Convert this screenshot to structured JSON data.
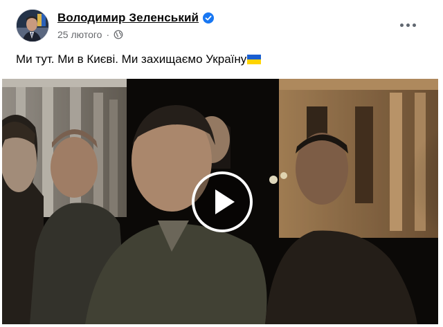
{
  "post": {
    "author": "Володимир Зеленський",
    "verified_icon": "verified-badge-icon",
    "date": "25 лютого",
    "separator": "·",
    "audience_icon": "globe-icon",
    "more_icon": "more-options-icon",
    "text": "Ми тут. Ми в Києві. Ми захищаємо Україну",
    "flag_emoji": "ukraine-flag-icon"
  },
  "video": {
    "play_icon": "play-icon"
  },
  "colors": {
    "verified_blue": "#1877f2",
    "meta_gray": "#65676b",
    "flag_blue": "#1a5fd0",
    "flag_yellow": "#ffd400"
  }
}
